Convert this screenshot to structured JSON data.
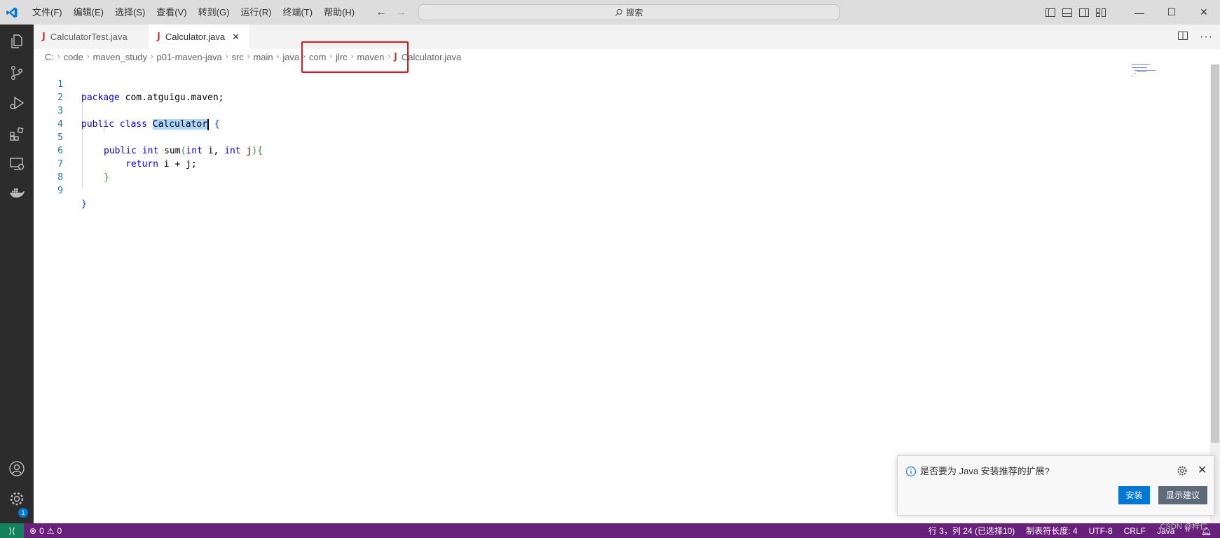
{
  "titlebar": {
    "menu": [
      "文件(F)",
      "编辑(E)",
      "选择(S)",
      "查看(V)",
      "转到(G)",
      "运行(R)",
      "终端(T)",
      "帮助(H)"
    ],
    "back": "←",
    "forward": "→",
    "search": "搜索",
    "minimize": "—",
    "maximize": "☐",
    "close": "✕"
  },
  "tabs": [
    {
      "label": "CalculatorTest.java",
      "active": false
    },
    {
      "label": "Calculator.java",
      "active": true,
      "close": "✕"
    }
  ],
  "breadcrumb": [
    "C:",
    "code",
    "maven_study",
    "p01-maven-java",
    "src",
    "main",
    "java",
    "com",
    "jlrc",
    "maven",
    "Calculator.java"
  ],
  "breadcrumb_sep": "›",
  "icon_letter": "J",
  "editor": {
    "line_numbers": [
      "1",
      "2",
      "3",
      "4",
      "5",
      "6",
      "7",
      "8",
      "9"
    ],
    "line1": {
      "kw": "package",
      "rest": " com.atguigu.maven;"
    },
    "line3": {
      "kw": "public class",
      "space": " ",
      "sel": "Calculator",
      "after": " ",
      "brace": "{"
    },
    "line5": {
      "kw1": "public int",
      "name": " sum",
      "p_open": "(",
      "kw2": "int",
      "mid": " i, ",
      "kw3": "int",
      "arg": " j",
      "p_close": ")",
      "brace": "{"
    },
    "line6": {
      "kw": "return",
      "rest": " i + j;"
    },
    "line7": {
      "brace": "}"
    },
    "line9": {
      "brace": "}"
    }
  },
  "notification": {
    "message": "是否要为 Java 安装推荐的扩展?",
    "primary": "安装",
    "secondary": "显示建议"
  },
  "statusbar": {
    "remote": "⟩⟨",
    "errors": "0",
    "warnings": "0",
    "position": "行 3，列 24 (已选择10)",
    "indent": "制表符长度: 4",
    "encoding": "UTF-8",
    "eol": "CRLF",
    "language": "Java"
  },
  "watermark": "CSDN @梓仁",
  "colors": {
    "statusbar": "#68217a",
    "remote": "#16825d",
    "accent": "#0078d4",
    "highlight": "#e3141b"
  }
}
